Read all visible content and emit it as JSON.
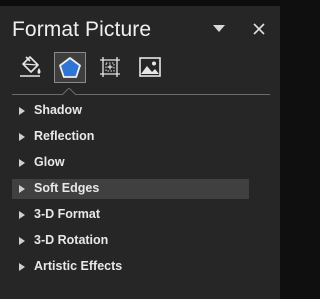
{
  "pane": {
    "title": "Format Picture",
    "dropdown_icon": "chevron-down-icon",
    "close_icon": "close-icon"
  },
  "category_tabs": [
    {
      "name": "Fill & Line",
      "icon": "paint-bucket-icon",
      "selected": false
    },
    {
      "name": "Effects",
      "icon": "pentagon-icon",
      "selected": true
    },
    {
      "name": "Size & Properties",
      "icon": "size-properties-icon",
      "selected": false
    },
    {
      "name": "Picture",
      "icon": "picture-icon",
      "selected": false
    }
  ],
  "sections": [
    {
      "label": "Shadow",
      "expanded": false,
      "highlighted": false
    },
    {
      "label": "Reflection",
      "expanded": false,
      "highlighted": false
    },
    {
      "label": "Glow",
      "expanded": false,
      "highlighted": false
    },
    {
      "label": "Soft Edges",
      "expanded": false,
      "highlighted": true
    },
    {
      "label": "3-D Format",
      "expanded": false,
      "highlighted": false
    },
    {
      "label": "3-D Rotation",
      "expanded": false,
      "highlighted": false
    },
    {
      "label": "Artistic Effects",
      "expanded": false,
      "highlighted": false
    }
  ],
  "colors": {
    "pane_bg": "#262626",
    "selected_tab_bg": "#3e3e3e",
    "accent_blue": "#2e75d6",
    "hover_row": "#404040",
    "text": "#e8e8e8"
  }
}
